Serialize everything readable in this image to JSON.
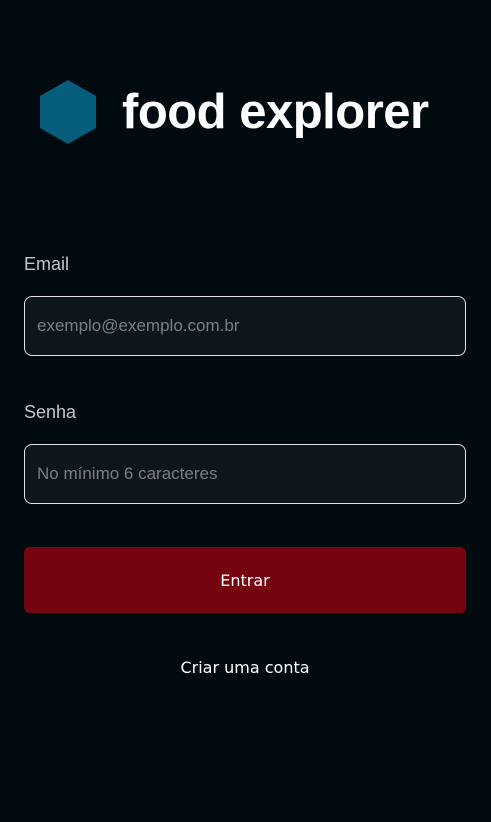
{
  "brand": {
    "name": "food explorer",
    "icon": "hexagon-icon",
    "icon_color": "#065E7C"
  },
  "form": {
    "email": {
      "label": "Email",
      "placeholder": "exemplo@exemplo.com.br",
      "value": ""
    },
    "password": {
      "label": "Senha",
      "placeholder": "No mínimo 6 caracteres",
      "value": ""
    },
    "submit_label": "Entrar",
    "create_account_label": "Criar uma conta"
  },
  "colors": {
    "background": "#000A0F",
    "input_background": "#0D161B",
    "button": "#750310",
    "text": "#C4C4CC",
    "white": "#FFFFFF"
  }
}
